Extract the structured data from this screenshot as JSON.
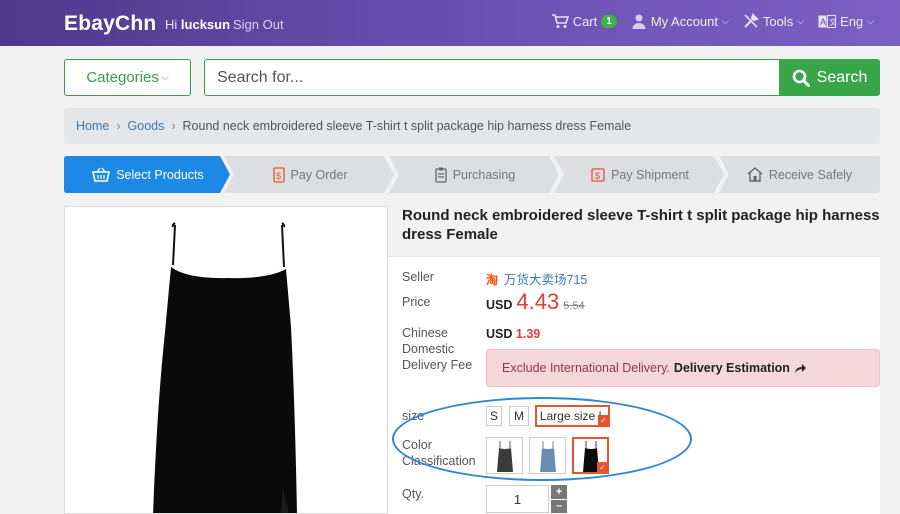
{
  "header": {
    "brand": "EbayChn",
    "greeting_prefix": "Hi",
    "username": "lucksun",
    "signout": "Sign Out",
    "cart_label": "Cart",
    "cart_count": "1",
    "account_label": "My Account",
    "tools_label": "Tools",
    "lang_label": "Eng"
  },
  "search": {
    "categories_label": "Categories",
    "placeholder": "Search for...",
    "button_label": "Search"
  },
  "breadcrumb": {
    "home": "Home",
    "goods": "Goods",
    "current": "Round neck embroidered sleeve T-shirt t split package hip harness dress Female"
  },
  "steps": [
    {
      "label": "Select Products",
      "active": true
    },
    {
      "label": "Pay Order",
      "active": false
    },
    {
      "label": "Purchasing",
      "active": false
    },
    {
      "label": "Pay Shipment",
      "active": false
    },
    {
      "label": "Receive Safely",
      "active": false
    }
  ],
  "product": {
    "title": "Round neck embroidered sleeve T-shirt t split package hip harness dress Female",
    "seller_label": "Seller",
    "seller_name": "万货大卖场715",
    "price_label": "Price",
    "currency": "USD",
    "price": "4.43",
    "old_price": "5.54",
    "shipping_label": "Chinese Domestic Delivery Fee",
    "shipping_currency": "USD",
    "shipping_fee": "1.39",
    "alert_text": "Exclude International Delivery.",
    "alert_link": "Delivery Estimation",
    "size_label": "size",
    "sizes": [
      "S",
      "M",
      "Large size L"
    ],
    "selected_size": "Large size L",
    "color_label": "Color Classification",
    "qty_label": "Qty.",
    "qty_value": "1"
  },
  "colors": {
    "accent_green": "#3aa64a",
    "step_active": "#1e88e5",
    "price_red": "#e4393c",
    "selection_outline": "#2f86d6"
  }
}
